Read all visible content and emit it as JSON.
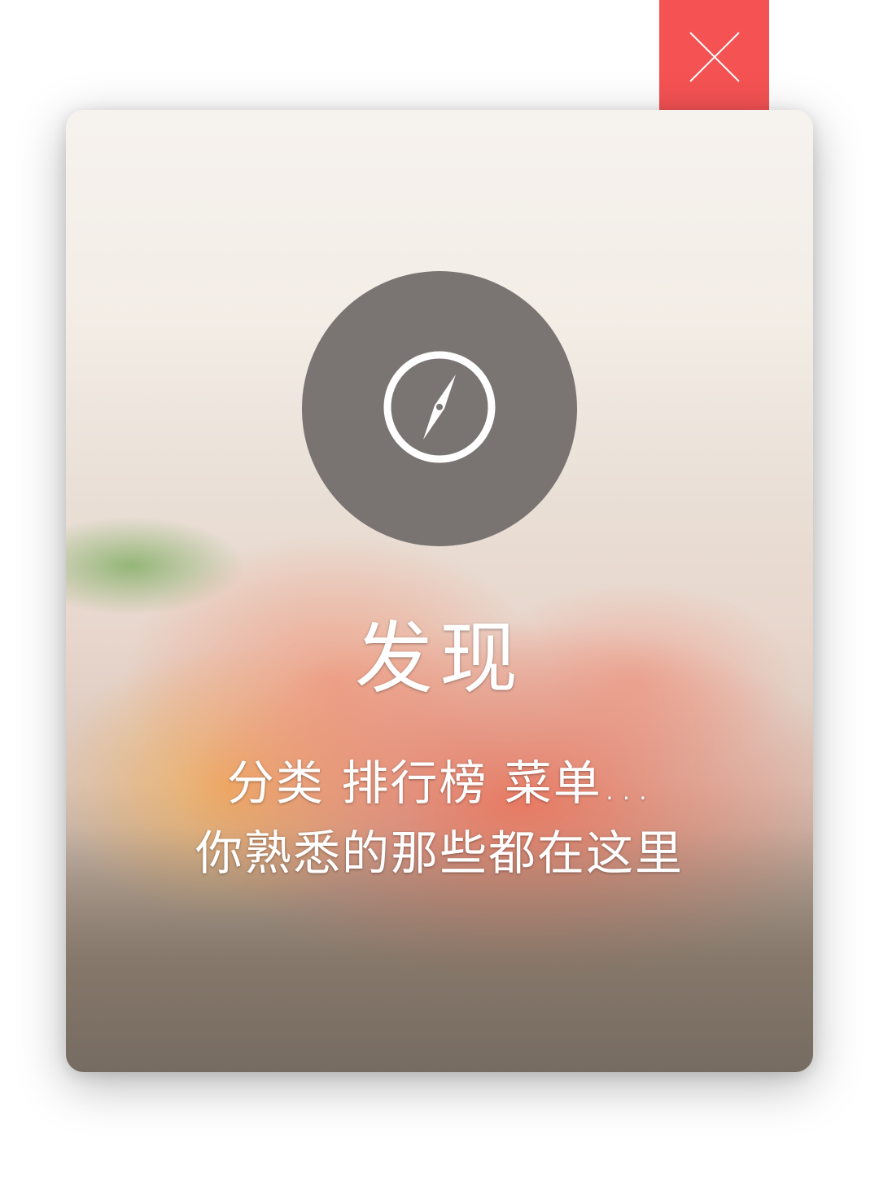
{
  "close": {
    "icon": "close-icon",
    "color": "#f55253"
  },
  "card": {
    "icon": "compass-icon",
    "title": "发现",
    "subtitle_line1": "分类  排行榜  菜单...",
    "subtitle_line2": "你熟悉的那些都在这里"
  }
}
